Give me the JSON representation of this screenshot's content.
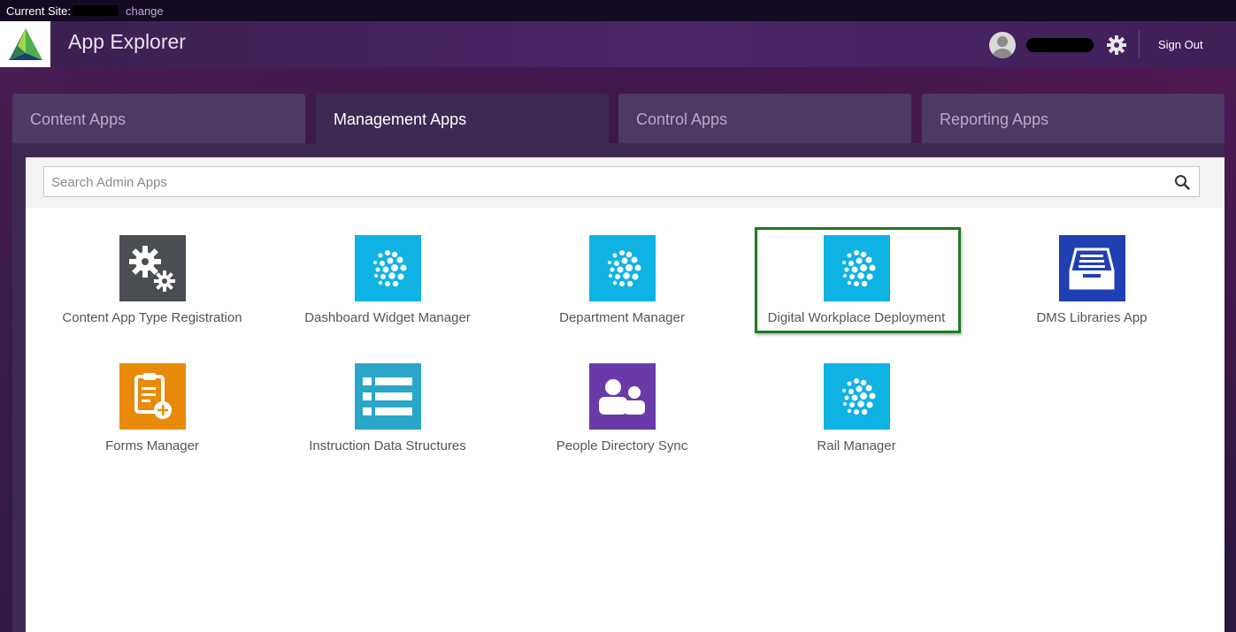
{
  "site_bar": {
    "label": "Current Site:",
    "change_link": "change"
  },
  "header": {
    "title": "App Explorer",
    "sign_out": "Sign Out"
  },
  "tabs": [
    {
      "label": "Content Apps",
      "active": false
    },
    {
      "label": "Management Apps",
      "active": true
    },
    {
      "label": "Control Apps",
      "active": false
    },
    {
      "label": "Reporting Apps",
      "active": false
    }
  ],
  "search": {
    "placeholder": "Search Admin Apps",
    "value": ""
  },
  "apps": [
    {
      "label": "Content App Type Registration",
      "icon": "gears-icon",
      "color": "#4a4e53"
    },
    {
      "label": "Dashboard Widget Manager",
      "icon": "globe-dots-icon",
      "color": "#0fb3e3"
    },
    {
      "label": "Department Manager",
      "icon": "globe-dots-icon",
      "color": "#0fb3e3"
    },
    {
      "label": "Digital Workplace Deployment",
      "icon": "globe-dots-icon",
      "color": "#0fb3e3",
      "highlighted": true
    },
    {
      "label": "DMS Libraries App",
      "icon": "inbox-tray-icon",
      "color": "#1f3fb3"
    },
    {
      "label": "Forms Manager",
      "icon": "clipboard-add-icon",
      "color": "#e88a0a"
    },
    {
      "label": "Instruction Data Structures",
      "icon": "list-icon",
      "color": "#2aa6c8"
    },
    {
      "label": "People Directory Sync",
      "icon": "people-icon",
      "color": "#6a3aa8"
    },
    {
      "label": "Rail Manager",
      "icon": "globe-dots-icon",
      "color": "#0fb3e3"
    }
  ],
  "colors": {
    "header_purple": "#4a2668",
    "highlight_green": "#1f7a1f",
    "tab_active": "#3d2a52",
    "tab_inactive": "#4d3a62"
  }
}
